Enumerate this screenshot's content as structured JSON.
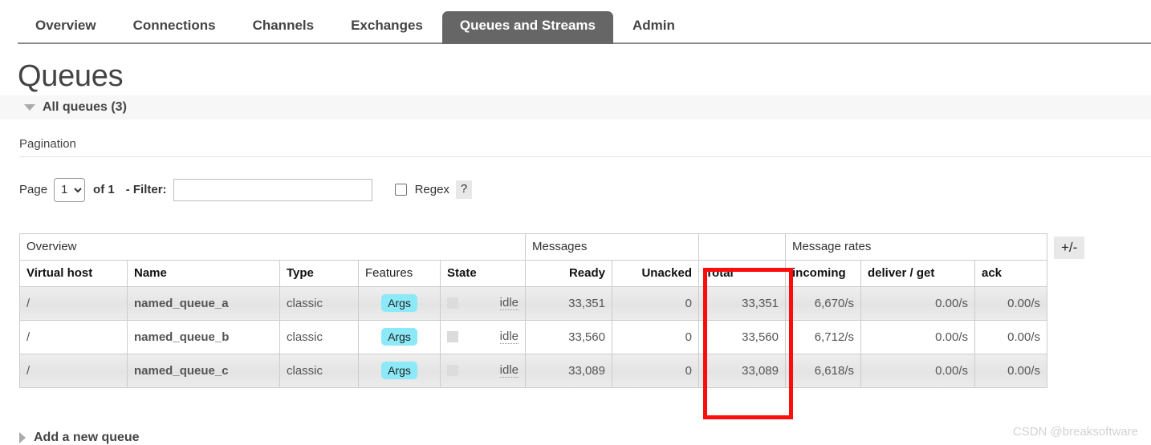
{
  "nav": {
    "tabs": [
      {
        "label": "Overview",
        "active": false
      },
      {
        "label": "Connections",
        "active": false
      },
      {
        "label": "Channels",
        "active": false
      },
      {
        "label": "Exchanges",
        "active": false
      },
      {
        "label": "Queues and Streams",
        "active": true
      },
      {
        "label": "Admin",
        "active": false
      }
    ],
    "active_tab_color": "#666666"
  },
  "page": {
    "title": "Queues",
    "section_band_label": "All queues (3)"
  },
  "pagination": {
    "title": "Pagination",
    "page_label": "Page",
    "page_value": "1",
    "page_options": [
      "1"
    ],
    "of_label": "of 1",
    "filter_label": "- Filter:",
    "filter_value": "",
    "filter_placeholder": "",
    "regex_label": "Regex",
    "regex_checked": false,
    "help_label": "?"
  },
  "table": {
    "group_headers": [
      {
        "label": "Overview",
        "span": 5
      },
      {
        "label": "Messages",
        "span": 2
      },
      {
        "label": "",
        "span": 1
      },
      {
        "label": "Message rates",
        "span": 3
      }
    ],
    "columns": [
      {
        "label": "Virtual host",
        "sortable": true,
        "align": "left"
      },
      {
        "label": "Name",
        "sortable": true,
        "align": "left"
      },
      {
        "label": "Type",
        "sortable": true,
        "align": "left"
      },
      {
        "label": "Features",
        "sortable": false,
        "align": "left"
      },
      {
        "label": "State",
        "sortable": true,
        "align": "left"
      },
      {
        "label": "Ready",
        "sortable": true,
        "align": "right"
      },
      {
        "label": "Unacked",
        "sortable": true,
        "align": "right"
      },
      {
        "label": "Total",
        "sortable": true,
        "align": "right"
      },
      {
        "label": "incoming",
        "sortable": true,
        "align": "right"
      },
      {
        "label": "deliver / get",
        "sortable": true,
        "align": "right"
      },
      {
        "label": "ack",
        "sortable": true,
        "align": "right"
      }
    ],
    "rows": [
      {
        "vhost": "/",
        "name": "named_queue_a",
        "type": "classic",
        "features": "Args",
        "state": "idle",
        "ready": "33,351",
        "unacked": "0",
        "total": "33,351",
        "incoming": "6,670/s",
        "deliver_get": "0.00/s",
        "ack": "0.00/s"
      },
      {
        "vhost": "/",
        "name": "named_queue_b",
        "type": "classic",
        "features": "Args",
        "state": "idle",
        "ready": "33,560",
        "unacked": "0",
        "total": "33,560",
        "incoming": "6,712/s",
        "deliver_get": "0.00/s",
        "ack": "0.00/s"
      },
      {
        "vhost": "/",
        "name": "named_queue_c",
        "type": "classic",
        "features": "Args",
        "state": "idle",
        "ready": "33,089",
        "unacked": "0",
        "total": "33,089",
        "incoming": "6,618/s",
        "deliver_get": "0.00/s",
        "ack": "0.00/s"
      }
    ],
    "toggle_columns_label": "+/-"
  },
  "annotation": {
    "color": "#fb0d0d",
    "target_column": "Total"
  },
  "footer": {
    "add_queue_label": "Add a new queue",
    "watermark": "CSDN @breaksoftware"
  },
  "colors": {
    "args_badge": "#8ce9f7",
    "active_tab": "#666666",
    "band": "#f7f7f7",
    "annotation": "#fb0d0d"
  }
}
